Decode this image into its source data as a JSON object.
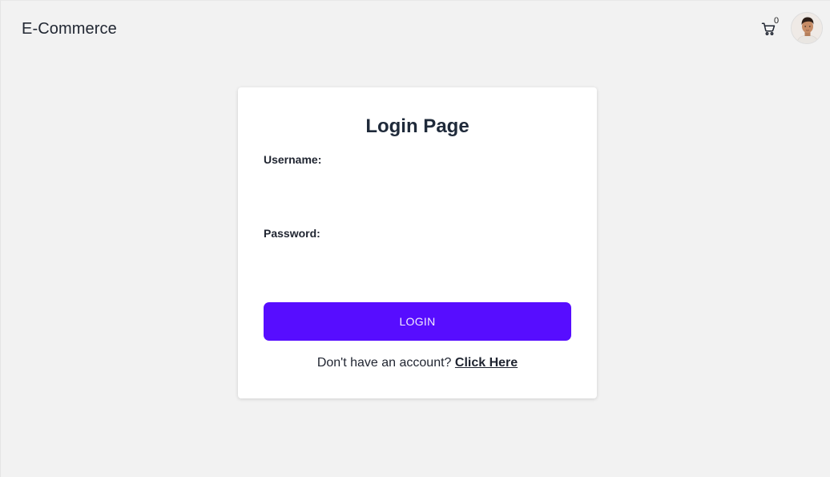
{
  "header": {
    "brand": "E-Commerce",
    "cart_icon": "cart-icon",
    "cart_count": "0",
    "avatar_icon": "user-avatar"
  },
  "login": {
    "title": "Login Page",
    "username_label": "Username:",
    "username_value": "",
    "password_label": "Password:",
    "password_value": "",
    "button_label": "LOGIN",
    "signup_prompt": "Don't have an account?",
    "signup_link": "Click Here"
  },
  "colors": {
    "background": "#f2f2f2",
    "card": "#ffffff",
    "primary_button": "#570dff",
    "text": "#1f2430"
  }
}
